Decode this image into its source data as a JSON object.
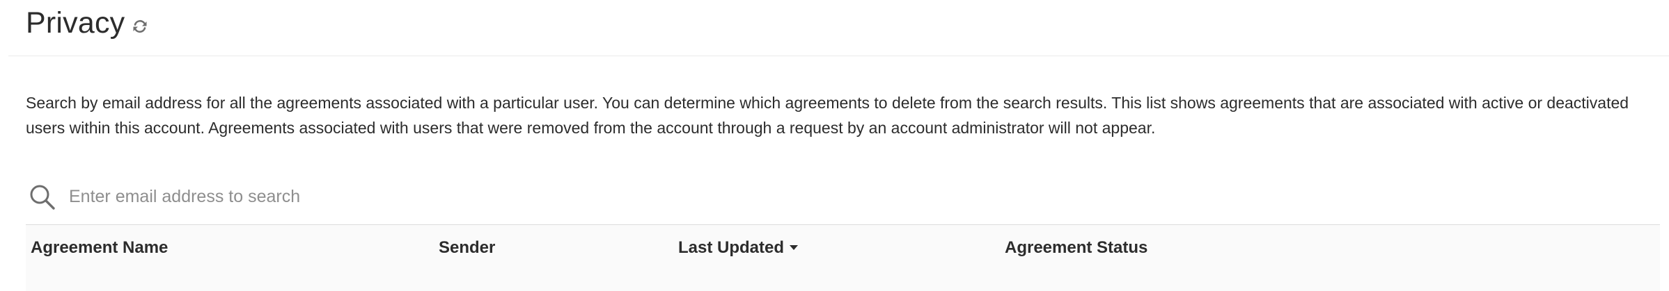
{
  "header": {
    "title": "Privacy",
    "refresh_icon": "refresh-icon"
  },
  "description": "Search by email address for all the agreements associated with a particular user. You can determine which agreements to delete from the search results. This list shows agreements that are associated with active or deactivated users within this account. Agreements associated with users that were removed from the account through a request by an account administrator will not appear.",
  "search": {
    "icon": "search-icon",
    "value": "",
    "placeholder": "Enter email address to search"
  },
  "table": {
    "columns": [
      {
        "label": "Agreement Name"
      },
      {
        "label": "Sender"
      },
      {
        "label": "Last Updated",
        "sorted": "descending"
      },
      {
        "label": "Agreement Status"
      }
    ],
    "rows": []
  },
  "colors": {
    "text": "#2c2c2c",
    "placeholder": "#8e8e8e",
    "icon": "#6e6e6e",
    "divider": "#dcdcdc",
    "header_bg": "#fafafa"
  }
}
